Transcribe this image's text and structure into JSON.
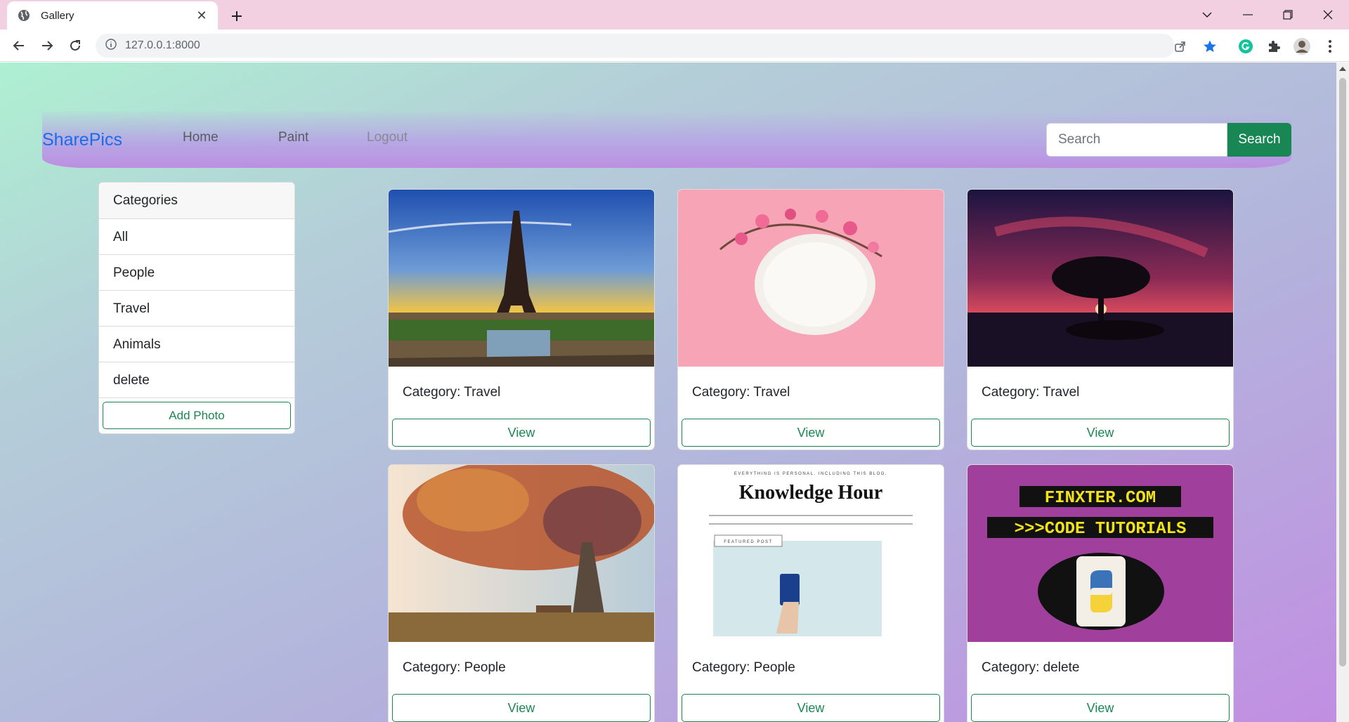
{
  "browser": {
    "tab_title": "Gallery",
    "url": "127.0.0.1:8000"
  },
  "navbar": {
    "brand": "SharePics",
    "links": [
      "Home",
      "Paint",
      "Logout"
    ],
    "search_placeholder": "Search",
    "search_button": "Search"
  },
  "sidebar": {
    "header": "Categories",
    "items": [
      "All",
      "People",
      "Travel",
      "Animals",
      "delete"
    ],
    "add_button": "Add Photo"
  },
  "cards": [
    {
      "category": "Category: Travel",
      "button": "View",
      "image": "eiffel-tower-sunset"
    },
    {
      "category": "Category: Travel",
      "button": "View",
      "image": "plate-with-flowers"
    },
    {
      "category": "Category: Travel",
      "button": "View",
      "image": "tree-sunset"
    },
    {
      "category": "Category: People",
      "button": "View",
      "image": "autumn-tree"
    },
    {
      "category": "Category: People",
      "button": "View",
      "image": "blog-screenshot"
    },
    {
      "category": "Category: delete",
      "button": "View",
      "image": "finxter-python"
    }
  ],
  "card_images_text": {
    "blog_tagline": "EVERYTHING IS PERSONAL. INCLUDING THIS BLOG.",
    "blog_title": "Knowledge Hour",
    "blog_badge": "FEATURED POST",
    "finxter_line1": "FINXTER.COM",
    "finxter_line2": ">>>CODE TUTORIALS"
  },
  "colors": {
    "brand": "#1a6ce8",
    "accent_green": "#198754"
  }
}
